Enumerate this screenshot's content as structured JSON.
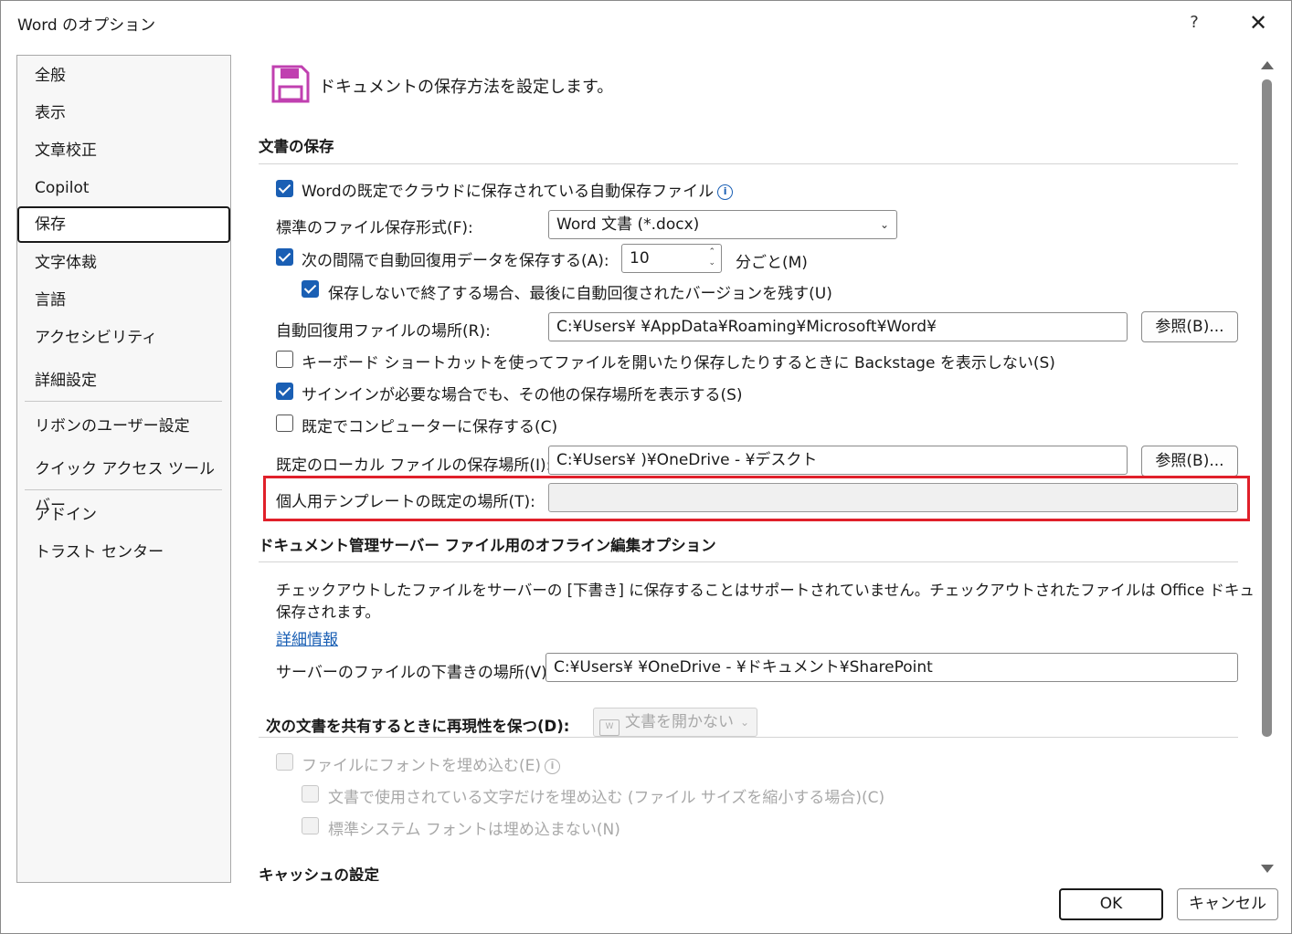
{
  "window": {
    "title": "Word のオプション",
    "help": "?",
    "close": "✕"
  },
  "sidebar": {
    "items": [
      {
        "label": "全般"
      },
      {
        "label": "表示"
      },
      {
        "label": "文章校正"
      },
      {
        "label": "Copilot"
      },
      {
        "label": "保存"
      },
      {
        "label": "文字体裁"
      },
      {
        "label": "言語"
      },
      {
        "label": "アクセシビリティ"
      },
      {
        "label": "詳細設定"
      },
      {
        "label": "リボンのユーザー設定"
      },
      {
        "label": "クイック アクセス ツール バー"
      },
      {
        "label": "アドイン"
      },
      {
        "label": "トラスト センター"
      }
    ],
    "selected": "保存"
  },
  "header": {
    "description": "ドキュメントの保存方法を設定します。",
    "icon": "save-floppy-icon"
  },
  "save_section": {
    "title": "文書の保存",
    "autosave_cloud": {
      "label": "Wordの既定でクラウドに保存されている自動保存ファイル",
      "checked": true
    },
    "format_label": "標準のファイル保存形式(F):",
    "format_value": "Word 文書 (*.docx)",
    "autorecover": {
      "label": "次の間隔で自動回復用データを保存する(A):",
      "checked": true
    },
    "interval_value": "10",
    "interval_unit": "分ごと(M)",
    "keep_last": {
      "label": "保存しないで終了する場合、最後に自動回復されたバージョンを残す(U)",
      "checked": true
    },
    "autorecover_location_label": "自動回復用ファイルの場所(R):",
    "autorecover_location_value": "C:¥Users¥                           ¥AppData¥Roaming¥Microsoft¥Word¥",
    "browse_label": "参照(B)...",
    "no_backstage": {
      "label": "キーボード ショートカットを使ってファイルを開いたり保存したりするときに Backstage を表示しない(S)",
      "checked": false
    },
    "show_other_locations": {
      "label": "サインインが必要な場合でも、その他の保存場所を表示する(S)",
      "checked": true
    },
    "save_to_computer": {
      "label": "既定でコンピューターに保存する(C)",
      "checked": false
    },
    "local_location_label": "既定のローカル ファイルの保存場所(I):",
    "local_location_value": "C:¥Users¥                         )¥OneDrive -                       ¥デスクト",
    "template_label": "個人用テンプレートの既定の場所(T):",
    "template_value": ""
  },
  "offline_section": {
    "title": "ドキュメント管理サーバー ファイル用のオフライン編集オプション",
    "notice_line1": "チェックアウトしたファイルをサーバーの [下書き] に保存することはサポートされていません。チェックアウトされたファイルは Office ドキュメント キャッシュに",
    "notice_line2": "保存されます。",
    "more_info": "詳細情報",
    "drafts_label": "サーバーのファイルの下書きの場所(V):",
    "drafts_value": "C:¥Users¥                         ¥OneDrive -                           ¥ドキュメント¥SharePoint"
  },
  "fidelity_section": {
    "title": "次の文書を共有するときに再現性を保つ(D):",
    "doc_select": "文書を開かない",
    "embed_fonts": {
      "label": "ファイルにフォントを埋め込む(E)",
      "checked": false
    },
    "embed_used_chars": {
      "label": "文書で使用されている文字だけを埋め込む (ファイル サイズを縮小する場合)(C)",
      "checked": false
    },
    "no_system_fonts": {
      "label": "標準システム フォントは埋め込まない(N)",
      "checked": false
    }
  },
  "cache_section": {
    "title": "キャッシュの設定"
  },
  "footer": {
    "ok": "OK",
    "cancel": "キャンセル"
  },
  "colors": {
    "accent": "#1a5fb4",
    "highlight": "#e0202a",
    "icon": "#c040b0"
  }
}
